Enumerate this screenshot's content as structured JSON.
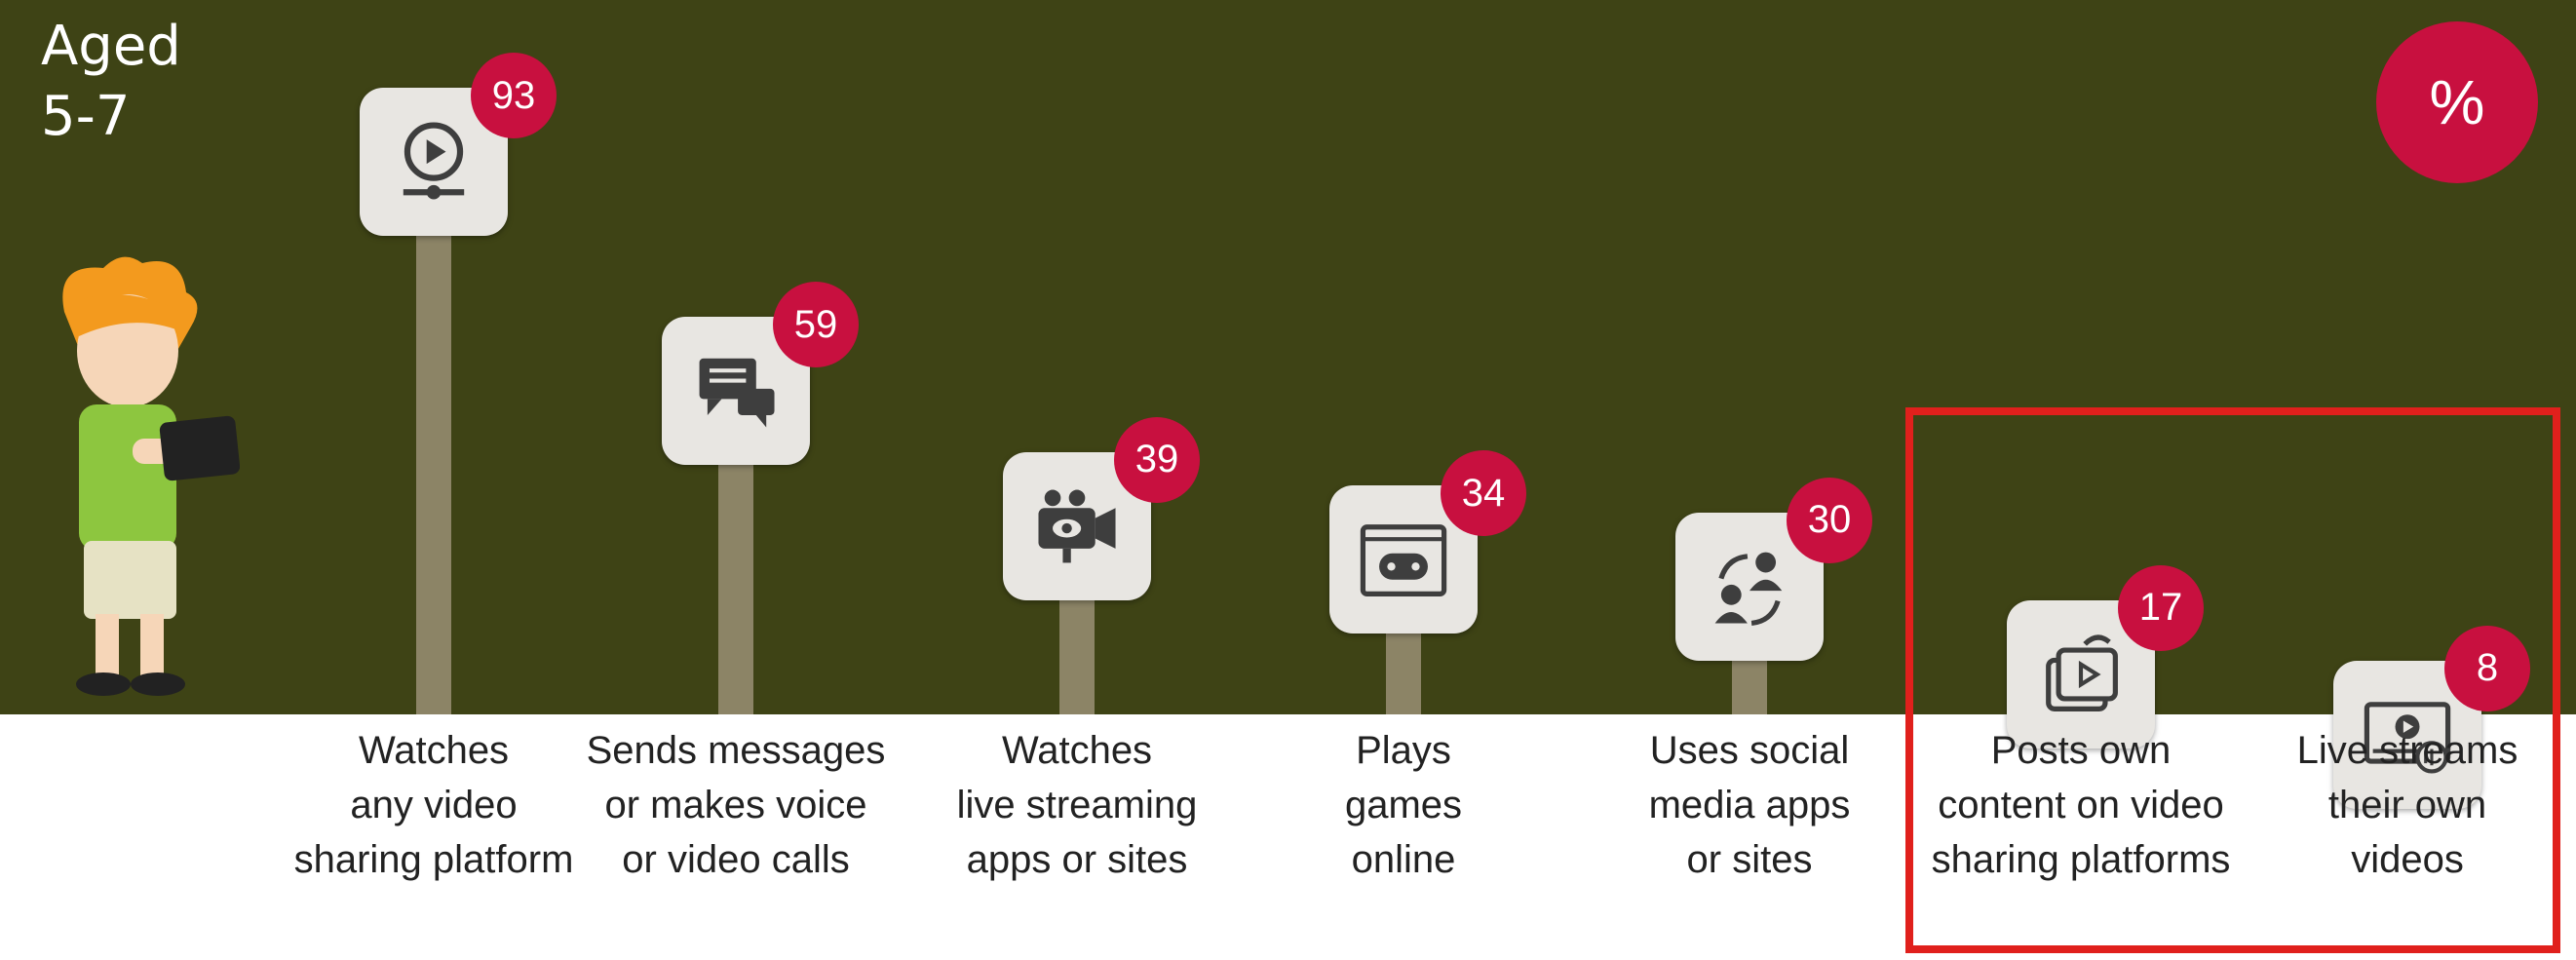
{
  "age_label": "Aged\n5-7",
  "unit_badge": "%",
  "colors": {
    "panel_bg": "#3e4315",
    "badge": "#c8103f",
    "pole": "#8c8466",
    "tile": "#e8e6e2",
    "icon": "#3e3e3e",
    "highlight_border": "#e0201c",
    "label_text": "#222222"
  },
  "chart_data": {
    "type": "bar",
    "categories": [
      "Watches\nany video\nsharing platform",
      "Sends messages\nor makes voice\nor video calls",
      "Watches\nlive streaming\napps or sites",
      "Plays\ngames\nonline",
      "Uses social\nmedia apps\nor sites",
      "Posts own\ncontent on video\nsharing platforms",
      "Live streams\ntheir own\nvideos"
    ],
    "values": [
      93,
      59,
      39,
      34,
      30,
      17,
      8
    ],
    "value_labels": [
      "93",
      "59",
      "39",
      "34",
      "30",
      "17",
      "8"
    ],
    "icons": [
      "video-player-icon",
      "chat-bubbles-icon",
      "video-camera-icon",
      "game-controller-icon",
      "social-people-icon",
      "share-video-icon",
      "livestream-screen-icon"
    ],
    "highlighted": [
      5,
      6
    ],
    "ylim": [
      0,
      100
    ],
    "grid": false
  }
}
